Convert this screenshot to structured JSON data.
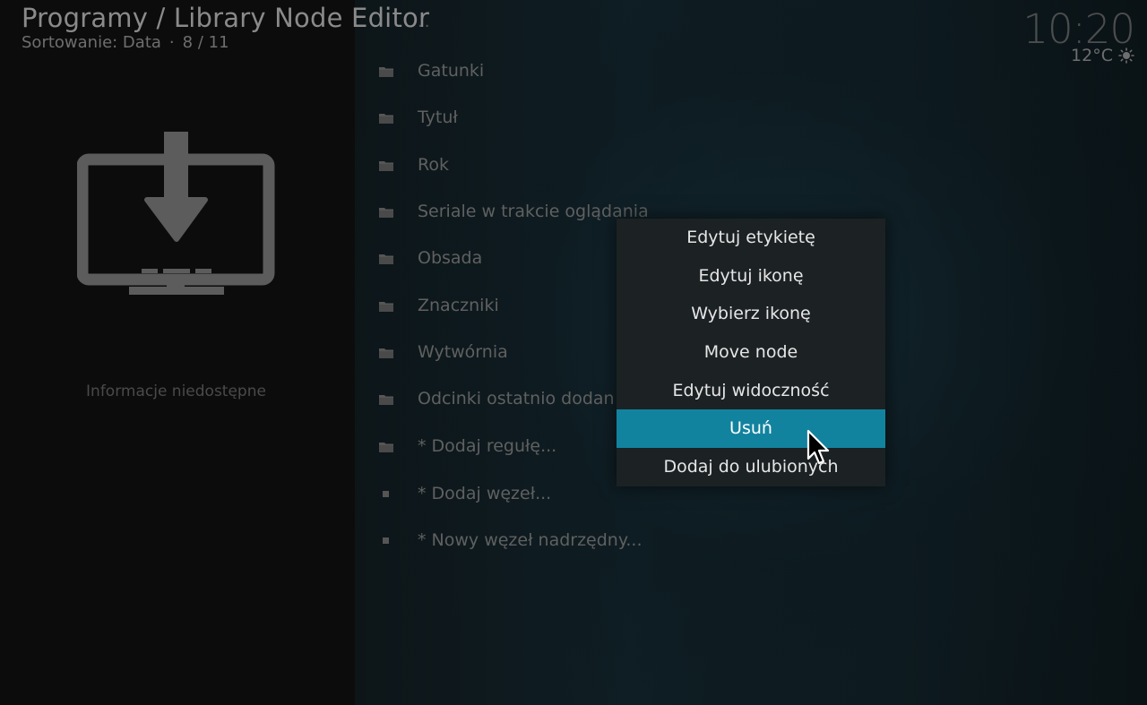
{
  "header": {
    "title": "Programy / Library Node Editor",
    "sort_label": "Sortowanie: Data",
    "separator": "·",
    "position": "8 / 11"
  },
  "status": {
    "time": "10:20",
    "temperature": "12°C",
    "weather_icon": "sun-icon"
  },
  "info_panel": {
    "icon": "download-to-monitor-icon",
    "text": "Informacje niedostępne"
  },
  "list": {
    "parent": "..",
    "items": [
      {
        "label": "Gatunki",
        "icon": "folder-icon"
      },
      {
        "label": "Tytuł",
        "icon": "folder-icon"
      },
      {
        "label": "Rok",
        "icon": "folder-icon"
      },
      {
        "label": "Seriale w trakcie oglądania",
        "icon": "folder-icon"
      },
      {
        "label": "Obsada",
        "icon": "folder-icon"
      },
      {
        "label": "Znaczniki",
        "icon": "folder-icon"
      },
      {
        "label": "Wytwórnia",
        "icon": "folder-icon"
      },
      {
        "label": "Odcinki ostatnio dodan",
        "icon": "folder-icon"
      },
      {
        "label": "* Dodaj regułę...",
        "icon": "folder-icon"
      },
      {
        "label": "* Dodaj węzeł...",
        "icon": "square-icon"
      },
      {
        "label": "* Nowy węzeł nadrzędny...",
        "icon": "square-icon"
      }
    ]
  },
  "context_menu": {
    "items": [
      {
        "label": "Edytuj etykietę"
      },
      {
        "label": "Edytuj ikonę"
      },
      {
        "label": "Wybierz ikonę"
      },
      {
        "label": "Move node"
      },
      {
        "label": "Edytuj widoczność"
      },
      {
        "label": "Usuń",
        "selected": true
      },
      {
        "label": "Dodaj do ulubionych"
      }
    ]
  },
  "colors": {
    "accent": "#12839f",
    "menu_bg": "#1c2124",
    "text_dim": "#606060"
  }
}
